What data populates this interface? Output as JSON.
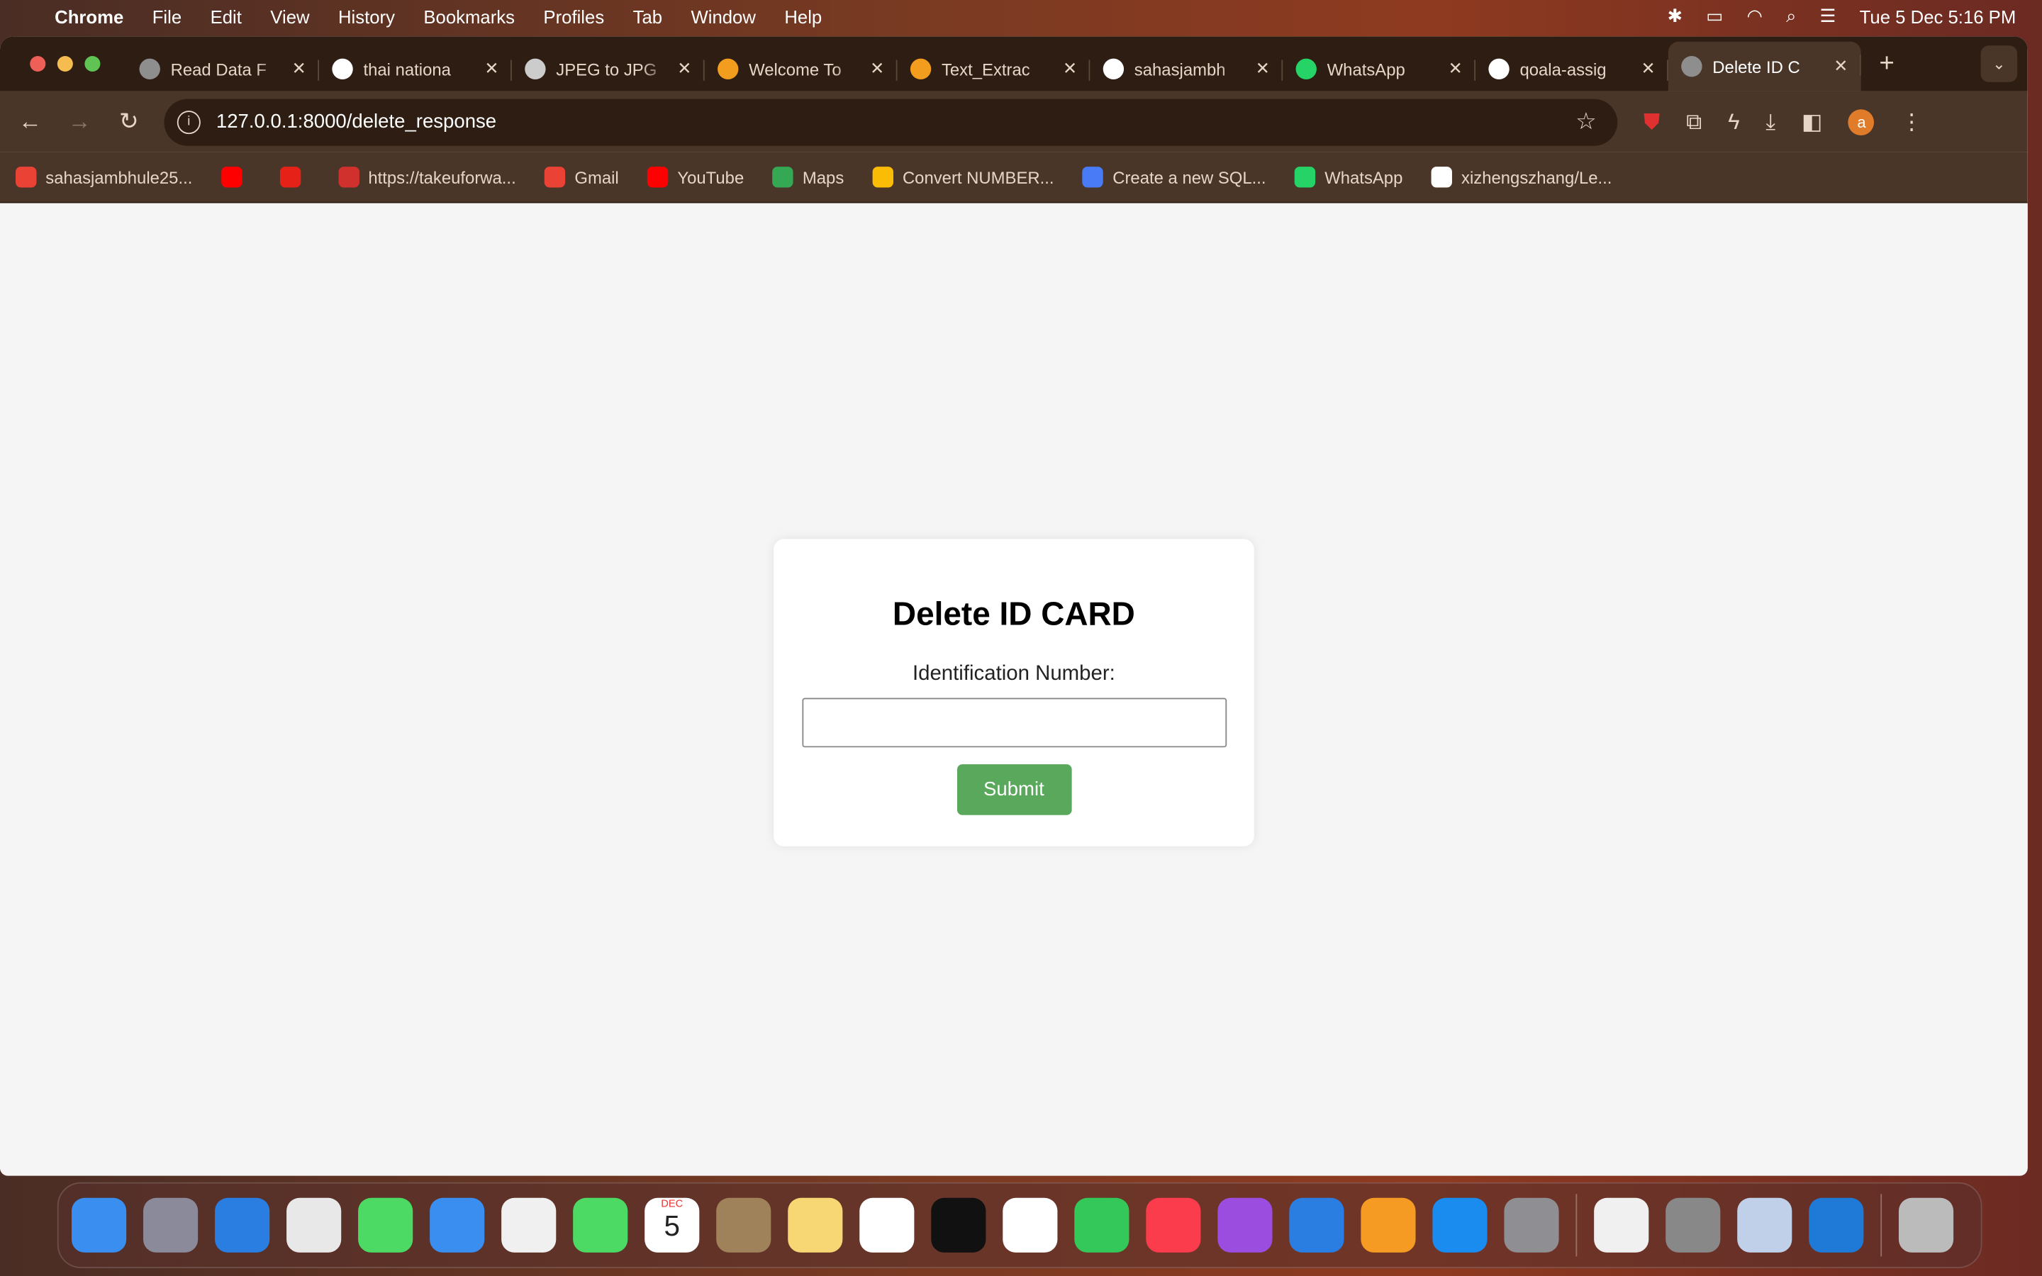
{
  "menubar": {
    "app": "Chrome",
    "items": [
      "File",
      "Edit",
      "View",
      "History",
      "Bookmarks",
      "Profiles",
      "Tab",
      "Window",
      "Help"
    ],
    "datetime": "Tue 5 Dec  5:16 PM"
  },
  "tabs": [
    {
      "title": "Read Data F",
      "icon": "globe-icon",
      "color": "#8e8e8e"
    },
    {
      "title": "thai nationa",
      "icon": "google-icon",
      "color": "#ffffff"
    },
    {
      "title": "JPEG to JPG",
      "icon": "cloud-icon",
      "color": "#cccccc"
    },
    {
      "title": "Welcome To",
      "icon": "colab-icon",
      "color": "#f29d1e"
    },
    {
      "title": "Text_Extrac",
      "icon": "colab-icon",
      "color": "#f29d1e"
    },
    {
      "title": "sahasjambh",
      "icon": "github-icon",
      "color": "#ffffff"
    },
    {
      "title": "WhatsApp",
      "icon": "whatsapp-icon",
      "color": "#25d366"
    },
    {
      "title": "qoala-assig",
      "icon": "github-icon",
      "color": "#ffffff"
    },
    {
      "title": "Delete ID C",
      "icon": "globe-icon",
      "color": "#8e8e8e",
      "active": true
    }
  ],
  "address": {
    "url": "127.0.0.1:8000/delete_response"
  },
  "profile_initial": "a",
  "bookmarks": [
    {
      "label": "sahasjambhule25...",
      "color": "#ea4335"
    },
    {
      "label": "",
      "color": "#ff0000"
    },
    {
      "label": "",
      "color": "#e62117"
    },
    {
      "label": "https://takeuforwa...",
      "color": "#d0312d"
    },
    {
      "label": "Gmail",
      "color": "#ea4335"
    },
    {
      "label": "YouTube",
      "color": "#ff0000"
    },
    {
      "label": "Maps",
      "color": "#34a853"
    },
    {
      "label": "Convert NUMBER...",
      "color": "#fbbc05"
    },
    {
      "label": "Create a new SQL...",
      "color": "#4a7bf7"
    },
    {
      "label": "WhatsApp",
      "color": "#25d366"
    },
    {
      "label": "xizhengszhang/Le...",
      "color": "#ffffff"
    }
  ],
  "form": {
    "title": "Delete ID CARD",
    "label": "Identification Number:",
    "value": "",
    "placeholder": "",
    "submit": "Submit",
    "submit_color": "#5aa85c"
  },
  "dock": [
    "Finder",
    "Launchpad",
    "Safari",
    "Chrome",
    "Messages",
    "Mail",
    "Photos",
    "FaceTime",
    "Calendar",
    "Contacts",
    "Notes",
    "Freeform",
    "TV",
    "Reminders",
    "Numbers",
    "Music",
    "Podcasts",
    "Keynote",
    "Pages",
    "App Store",
    "System Settings",
    "Python",
    "Database",
    "Settings Utility",
    "VS Code",
    "Trash"
  ],
  "calendar": {
    "month": "DEC",
    "day": "5"
  }
}
